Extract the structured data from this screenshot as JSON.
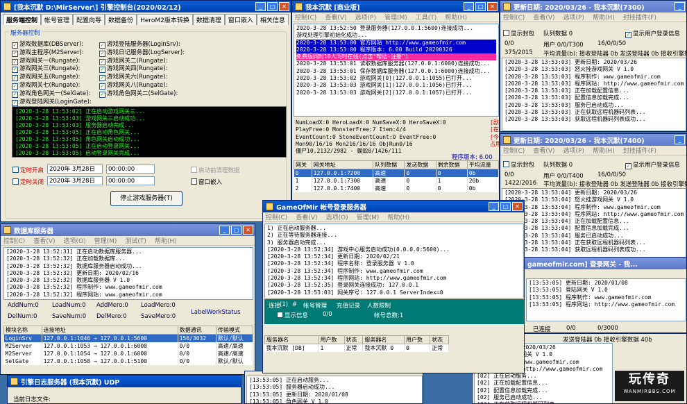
{
  "engine": {
    "title": "[我本沉默 D:\\MirServer\\] 引擎控制台(2020/02/12)",
    "tabs": [
      "服务端控制",
      "帐号管理",
      "配置向导",
      "数据备份",
      "HeroM2版本转换",
      "数据清理",
      "窗口嵌入",
      "相关信息"
    ],
    "group": "服务器控制",
    "left_checks": [
      "游戏数据库(DBServer):",
      "游戏主程序(M2Server):",
      "游戏网关一(Rungate):",
      "游戏网关三(Rungate):",
      "游戏网关五(Rungate):",
      "游戏网关七(Rungate):",
      "游戏角色网关一(SelGate):",
      "游戏登陆网关(LoginGate):"
    ],
    "right_checks": [
      "游戏登陆服务器(LoginSrv):",
      "游戏日记服务器(LogServer):",
      "游戏网关二(Rungate):",
      "游戏网关四(Rungate):",
      "游戏网关六(Rungate):",
      "游戏网关八(Rungate):",
      "游戏角色网关二(SelGate):"
    ],
    "console": "[2020-3-28 13:53:02] 正在启动游戏网关三...\n[2020-3-28 13:53:03] 游戏网关三启动成功...\n[2020-3-28 13:53:03] 服务器启动完成...\n[2020-3-28 13:53:05] 正在启动角色网关...\n[2020-3-28 13:53:05] 角色网关启动成功...\n[2020-3-28 13:53:05] 正在启动登录网关...\n[2020-3-28 13:53:05] 启动登录网关完成...",
    "timed_start": "定时开启",
    "timed_stop": "定时关闭",
    "date1": "2020年 3月28日",
    "date2": "2020年 3月28日",
    "time1": "00:00:00",
    "time2": "00:00:00",
    "clean_data": "启动前清理数据",
    "embed": "窗口嵌入",
    "stop_btn": "停止游戏服务器(T)"
  },
  "m2": {
    "title": "我本沉默 [商业版]",
    "menu": [
      "控制(C)",
      "查看(V)",
      "选项(P)",
      "管理(M)",
      "工具(T)",
      "帮助(H)"
    ],
    "log": [
      "2020-3-28 13:52:50 登录服务器(127.0.0.1:5600)连接成功...",
      "游戏处理引擎初始化成功...",
      "2020-3-28 13:53:00 官方网站 http://www.gameofmir.com",
      "2020-3-28 13:53:00 程序版本: 6.00 Build 20200326",
      "免费版同时10人同时在线(点击\"帮助-注册\")",
      "2020-3-28 13:53:01 读取数据库服务器(127.0.0.1:6000)连接成功...",
      "2020-3-28 13:53:01 保存数据库服务器(127.0.0.1:6000)连接成功...",
      "2020-3-28 13:53:02 游戏网关[0](127.0.0.1:1055)已打开...",
      "2020-3-28 13:53:03 游戏网关[1](127.0.0.1:1056)已打开...",
      "2020-3-28 13:53:03 游戏网关[2](127.0.0.1:1057)已打开..."
    ],
    "stats": [
      "NumLoadX:0 HeroLoadX:0 NumSaveX:0 HeroSaveX:0",
      "PlayFree:0 MonsterFree:7 Item:4/4",
      "EventCount:0 StoneEventCount:0 EventFree:0",
      "Mon90/16/16 Mon216/16/16 ObjRun0/16",
      "僵尸10,2132/2982 - 蜈蚣0/1426/111"
    ],
    "side": [
      "[剧",
      "[在",
      "[今",
      "占用"
    ],
    "version": "程序版本: 6.00",
    "cols": [
      "网关",
      "网关地址",
      "队列数据",
      "发送数据",
      "剩余数据",
      "平均流量"
    ],
    "rows": [
      [
        "0",
        "127.0.0.1:7200",
        "高速",
        "0",
        "0",
        "0b"
      ],
      [
        "1",
        "127.0.0.1:7300",
        "高速",
        "0",
        "1",
        "20b"
      ],
      [
        "2",
        "127.0.0.1:7400",
        "高速",
        "0",
        "0",
        "0b"
      ]
    ]
  },
  "upd1": {
    "title": "更新日期: 2020/03/26 - 我本沉默(7300)",
    "menu": [
      "控制(C)",
      "查看(V)",
      "选项(P)",
      "帮助(H)",
      "封挂插件(F)"
    ],
    "cb1": "显示封包",
    "queue": "队列数据 0",
    "cb2": "显示用户登录信息",
    "l1": "0/0",
    "l2": "用户 0/0/T300",
    "l3": "16/0/0/50",
    "l4": "375/2015",
    "l5": "平均流量(b): 接收登陆器 0b 发送登陆器 0b 接收引擎数",
    "log": "[2020-3-28 13:53:03] 更新日期: 2020/03/26\n[2020-3-28 13:53:03] 怒火挂游戏网关 V 1.0\n[2020-3-28 13:53:03] 程序制作: www.gameofmir.com\n[2020-3-28 13:53:03] 程序网站: http://www.gameofmir.com\n[2020-3-28 13:53:03] 正在加载配置信息...\n[2020-3-28 13:53:03] 配置信息加载完成...\n[2020-3-28 13:53:03] 服务已启动成功...\n[2020-3-28 13:53:03] 正在获取远程机器码列表...\n[2020-3-28 13:53:03] 获取远程机器码列表成功..."
  },
  "upd2": {
    "title": "更新日期: 2020/03/26 - 我本沉默(7400)",
    "menu": [
      "控制(C)",
      "查看(V)",
      "选项(P)",
      "帮助(H)",
      "封挂插件(F)"
    ],
    "cb1": "显示封包",
    "queue": "队列数据 0",
    "cb2": "显示用户登录信息",
    "l1": "0/0",
    "l2": "用户 0/0/T400",
    "l3": "16/0/0/50",
    "l4": "1422/2016",
    "l5": "平均流量(b): 接收登陆器 0b 发送登陆器 0b 接收引擎数",
    "log": "[2020-3-28 13:53:04] 更新日期: 2020/03/26\n[2020-3-28 13:53:04] 怒火挂游戏网关 V 1.0\n[2020-3-28 13:53:04] 程序制作: www.gameofmir.com\n[2020-3-28 13:53:04] 程序网站: http://www.gameofmir.com\n[2020-3-28 13:53:04] 正在加载配置信息...\n[2020-3-28 13:53:04] 配置信息加载完成...\n[2020-3-28 13:53:04] 服务已启动成功...\n[2020-3-28 13:53:04] 正在获取远程机器码列表...\n[2020-3-28 13:53:04] 获取远程机器码列表成功..."
  },
  "db": {
    "title": "数据库服务器",
    "menu": [
      "控制(C)",
      "查看(V)",
      "选项(O)",
      "管理(M)",
      "测试(T)",
      "帮助(H)"
    ],
    "log": "[2020-3-28 13:52:31] 正在启动数据库服务器...\n[2020-3-28 13:52:32] 正在加载数据库...\n[2020-3-28 13:52:32] 数据库服务器启动成功...\n[2020-3-28 13:52:32] 更新日期: 2020/02/16\n[2020-3-28 13:52:32] 数据库服务器 V 1.0\n[2020-3-28 13:52:32] 程序制作: www.gameofmir.com\n[2020-3-28 13:52:32] 程序网站: www.gameofmir.com",
    "nums1": [
      "AddNum:0",
      "LoadNum:0",
      "AddMero:0",
      "LoadMero:0"
    ],
    "label": "LabelWorkStatus",
    "nums2": [
      "DelNum:0",
      "SaveNum:0",
      "DelMero:0",
      "SaveMero:0"
    ],
    "cols": [
      "模块名称",
      "连接地址",
      "数据通讯",
      "传输模式"
    ],
    "rows": [
      [
        "LoginSrv",
        "127.0.0.1:1046 → 127.0.0.1:5600",
        "156/3032",
        "默认/默认"
      ],
      [
        "M2Server",
        "127.0.0.1:1053 → 127.0.0.1:6000",
        "0/0",
        "高速/高速"
      ],
      [
        "M2Server",
        "127.0.0.1:1054 → 127.0.0.1:6000",
        "0/0",
        "高速/高速"
      ],
      [
        "SelGate",
        "127.0.0.1:1058 → 127.0.0.1:5100",
        "0/0",
        "默认/默认"
      ]
    ]
  },
  "login": {
    "title": "GameOfMir 帐号登录服务器",
    "menu": [
      "控制(C)",
      "查看(V)",
      "选项(O)",
      "管理(M)",
      "帮助(H)"
    ],
    "log": "1) 正在启动服务器...\n2) 正在等待服务器连接...\n3) 服务器启动完成...\n[2020-3-28 13:52:34] 游戏中心服务启动成功(0.0.0.0:5600)...\n[2020-3-28 13:52:34] 更新日期: 2020/02/21\n[2020-3-28 13:52:34] 程序名称: 登录服务器 V 1.0\n[2020-3-28 13:52:34] 程序制作: www.gameofmir.com\n[2020-3-28 13:52:34] 程序网站: http://www.gameofmir.com\n[2020-3-28 13:52:35] 登录网关连接成功: 127.0.0.1\n[2020-3-28 13:53:03] 网关序号: 127.0.0.1 ServerIndex=0",
    "bar": [
      "连接",
      "(1)",
      "#",
      "帐号管理",
      "充值记录",
      "人数限制"
    ],
    "show_info": "显示信息",
    "ratio": "0/0",
    "acct": "帐号总数:1",
    "cols": [
      "服务器名",
      "用户数",
      "状态",
      "服务器名",
      "用户数",
      "状态"
    ],
    "rows": [
      [
        "我本沉默 [DB]",
        "1",
        "正常",
        "我本沉默 0",
        "0",
        "正常"
      ]
    ]
  },
  "logingate": {
    "title": "gameofmir.com] 登录网关 - 我...",
    "log": "[13:53:05] 更新日期: 2020/01/08\n[13:53:05] 登陆网关 V 1.0\n[13:53:05] 程序制作: www.gameofmir.com\n[13:53:05] 程序网站: http://www.gameofmir.com",
    "status": "已连接",
    "s2": "0/0",
    "s3": "0/3000"
  },
  "gate3": {
    "log": "[02] 更新日期: 2020/03/26\n[02] 反外挂游戏网关 V 1.0\n[02] 程序制作: www.gameofmir.com\n[02] 程序网站: http://www.gameofmir.com\n[02] 正在启动服务...\n[02] 正在加载配置信息...\n[02] 配置信息加载完成...\n[02] 服务已启动成功...\n[02] 正在获取远程机器码列表...\n[02] 获取远程机器码列表成功...",
    "traffic": "发送登陆器 0b 接收引擎数据 40b"
  },
  "sel": {
    "log": "[13:53:05] 正在启动服务...\n[13:53:05] 服务器启动成功...\n[13:53:05] 更新日期: 2020/01/08\n[13:53:05] 角色网关 V 1.0"
  },
  "logsrv": {
    "title": "引擎日志服务器 (我本沉默) UDP",
    "file": "当前日志文件:"
  },
  "brand": {
    "big": "玩传奇",
    "small": "WANMIRBBS.COM"
  }
}
